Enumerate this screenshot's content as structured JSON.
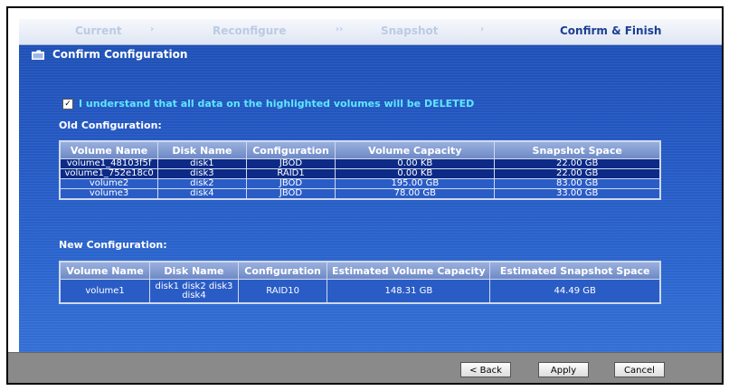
{
  "wizard": {
    "steps": [
      "Current",
      "Reconfigure",
      "Snapshot",
      "Confirm & Finish"
    ],
    "active_step": "Confirm & Finish"
  },
  "page": {
    "title": "Confirm Configuration",
    "confirm_checkbox_label": "I understand that all data on the highlighted volumes will be DELETED",
    "confirm_checked": true
  },
  "old_config": {
    "label": "Old Configuration:",
    "headers": [
      "Volume Name",
      "Disk Name",
      "Configuration",
      "Volume Capacity",
      "Snapshot Space"
    ],
    "rows": [
      {
        "volume": "volume1_48103f5f",
        "disk": "disk1",
        "config": "JBOD",
        "capacity": "0.00 KB",
        "snapshot": "22.00 GB",
        "highlighted": true
      },
      {
        "volume": "volume1_752e18c0",
        "disk": "disk3",
        "config": "RAID1",
        "capacity": "0.00 KB",
        "snapshot": "22.00 GB",
        "highlighted": true
      },
      {
        "volume": "volume2",
        "disk": "disk2",
        "config": "JBOD",
        "capacity": "195.00 GB",
        "snapshot": "83.00 GB",
        "highlighted": false
      },
      {
        "volume": "volume3",
        "disk": "disk4",
        "config": "JBOD",
        "capacity": "78.00 GB",
        "snapshot": "33.00 GB",
        "highlighted": false
      }
    ]
  },
  "new_config": {
    "label": "New Configuration:",
    "headers": [
      "Volume Name",
      "Disk Name",
      "Configuration",
      "Estimated Volume Capacity",
      "Estimated Snapshot Space"
    ],
    "rows": [
      {
        "volume": "volume1",
        "disk": "disk1 disk2 disk3 disk4",
        "config": "RAID10",
        "capacity": "148.31 GB",
        "snapshot": "44.49 GB"
      }
    ]
  },
  "footer": {
    "back_label": "< Back",
    "apply_label": "Apply",
    "cancel_label": "Cancel"
  },
  "colors": {
    "panel_blue": "#2356c0",
    "highlight_row": "#0c2a86",
    "warning_text": "#5fe7ff",
    "active_step": "#1b3f91"
  }
}
